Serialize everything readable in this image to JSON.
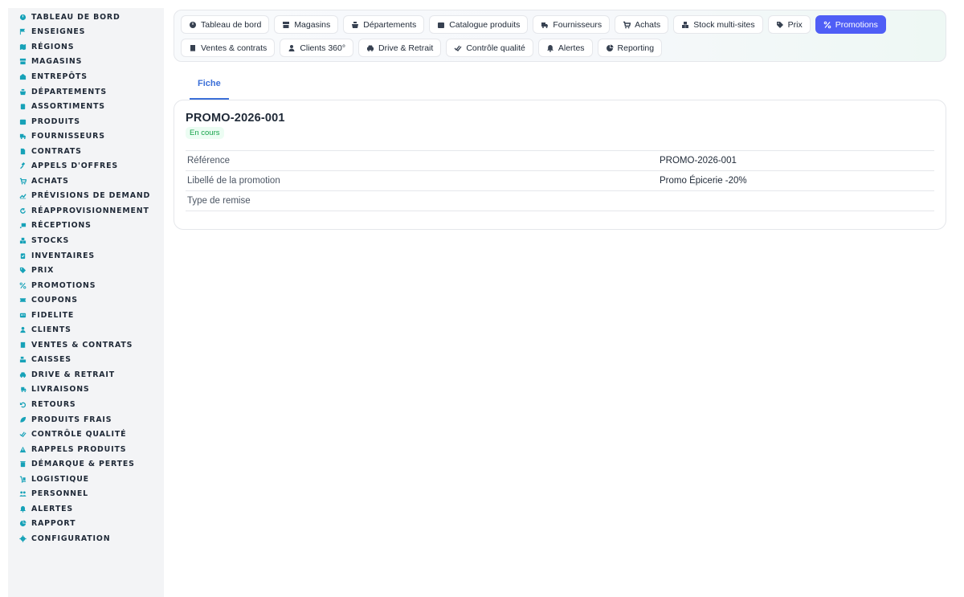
{
  "sidebar": {
    "items": [
      {
        "label": "Tableau de bord",
        "icon": "dashboard-icon"
      },
      {
        "label": "Enseignes",
        "icon": "flag-icon"
      },
      {
        "label": "Régions",
        "icon": "map-icon"
      },
      {
        "label": "Magasins",
        "icon": "store-icon"
      },
      {
        "label": "Entrepôts",
        "icon": "warehouse-icon"
      },
      {
        "label": "Départements",
        "icon": "basket-icon"
      },
      {
        "label": "Assortiments",
        "icon": "clipboard-icon"
      },
      {
        "label": "Produits",
        "icon": "box-icon"
      },
      {
        "label": "Fournisseurs",
        "icon": "truck-icon"
      },
      {
        "label": "Contrats",
        "icon": "file-icon"
      },
      {
        "label": "Appels d'offres",
        "icon": "gavel-icon"
      },
      {
        "label": "Achats",
        "icon": "cart-icon"
      },
      {
        "label": "Prévisions de demand",
        "icon": "chart-line-icon"
      },
      {
        "label": "Réapprovisionnement",
        "icon": "refresh-icon"
      },
      {
        "label": "Réceptions",
        "icon": "truck-loading-icon"
      },
      {
        "label": "Stocks",
        "icon": "boxes-icon"
      },
      {
        "label": "Inventaires",
        "icon": "clipboard-check-icon"
      },
      {
        "label": "Prix",
        "icon": "tags-icon"
      },
      {
        "label": "Promotions",
        "icon": "percent-icon"
      },
      {
        "label": "Coupons",
        "icon": "ticket-icon"
      },
      {
        "label": "Fidelite",
        "icon": "id-card-icon"
      },
      {
        "label": "Clients",
        "icon": "user-icon"
      },
      {
        "label": "Ventes & contrats",
        "icon": "receipt-icon"
      },
      {
        "label": "Caisses",
        "icon": "cash-register-icon"
      },
      {
        "label": "Drive & retrait",
        "icon": "car-icon"
      },
      {
        "label": "Livraisons",
        "icon": "shipping-fast-icon"
      },
      {
        "label": "Retours",
        "icon": "undo-icon"
      },
      {
        "label": "Produits frais",
        "icon": "leaf-icon"
      },
      {
        "label": "Contrôle qualité",
        "icon": "check-double-icon"
      },
      {
        "label": "Rappels produits",
        "icon": "warning-icon"
      },
      {
        "label": "Démarque & pertes",
        "icon": "trash-icon"
      },
      {
        "label": "Logistique",
        "icon": "dolly-icon"
      },
      {
        "label": "Personnel",
        "icon": "users-icon"
      },
      {
        "label": "Alertes",
        "icon": "bell-icon"
      },
      {
        "label": "Rapport",
        "icon": "pie-chart-icon"
      },
      {
        "label": "Configuration",
        "icon": "gear-icon"
      }
    ]
  },
  "topnav": {
    "row1": [
      {
        "label": "Tableau de bord",
        "icon": "dashboard-icon"
      },
      {
        "label": "Magasins",
        "icon": "store-icon"
      },
      {
        "label": "Départements",
        "icon": "basket-icon"
      },
      {
        "label": "Catalogue produits",
        "icon": "box-icon"
      },
      {
        "label": "Fournisseurs",
        "icon": "truck-icon"
      },
      {
        "label": "Achats",
        "icon": "cart-icon"
      },
      {
        "label": "Stock multi-sites",
        "icon": "boxes-icon"
      },
      {
        "label": "Prix",
        "icon": "tags-icon"
      },
      {
        "label": "Promotions",
        "icon": "percent-icon",
        "active": true
      }
    ],
    "row2": [
      {
        "label": "Ventes & contrats",
        "icon": "receipt-icon"
      },
      {
        "label": "Clients 360°",
        "icon": "user-icon"
      },
      {
        "label": "Drive & Retrait",
        "icon": "car-icon"
      },
      {
        "label": "Contrôle qualité",
        "icon": "check-double-icon"
      },
      {
        "label": "Alertes",
        "icon": "bell-icon"
      },
      {
        "label": "Reporting",
        "icon": "pie-chart-icon"
      }
    ]
  },
  "tabs": [
    {
      "label": "Fiche",
      "active": true
    }
  ],
  "record": {
    "title": "PROMO-2026-001",
    "status": "En cours",
    "fields": [
      {
        "label": "Référence",
        "value": "PROMO-2026-001"
      },
      {
        "label": "Libellé de la promotion",
        "value": "Promo Épicerie -20%"
      },
      {
        "label": "Type de remise",
        "value": ""
      }
    ]
  },
  "colors": {
    "sidebar_icon": "#17a2b8",
    "active_nav": "#4f5ef6",
    "tab_accent": "#3b6fd8",
    "status_green": "#16a34a"
  }
}
